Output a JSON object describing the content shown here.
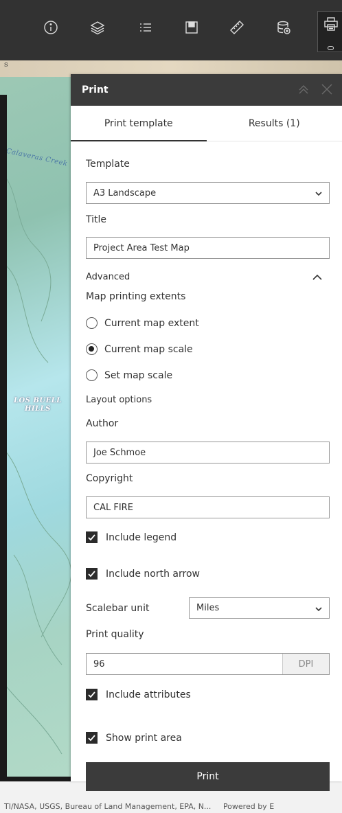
{
  "map": {
    "edge_label": "s",
    "creek_label": "Calaveras Creek",
    "hills_label_1": "LOS BUELL",
    "hills_label_2": "HILLS"
  },
  "attribution": {
    "text": "TI/NASA, USGS, Bureau of Land Management, EPA, N...",
    "powered": "Powered by E"
  },
  "panel": {
    "title": "Print",
    "tabs": [
      {
        "label": "Print template"
      },
      {
        "label": "Results (1)"
      }
    ],
    "template_label": "Template",
    "template_value": "A3 Landscape",
    "title_label": "Title",
    "title_value": "Project Area Test Map",
    "advanced_label": "Advanced",
    "extents_label": "Map printing extents",
    "extents_options": [
      {
        "label": "Current map extent",
        "checked": false
      },
      {
        "label": "Current map scale",
        "checked": true
      },
      {
        "label": "Set map scale",
        "checked": false
      }
    ],
    "layout_label": "Layout options",
    "author_label": "Author",
    "author_value": "Joe Schmoe",
    "copyright_label": "Copyright",
    "copyright_value": "CAL FIRE",
    "include_legend": "Include legend",
    "include_north_arrow": "Include north arrow",
    "scalebar_label": "Scalebar unit",
    "scalebar_value": "Miles",
    "quality_label": "Print quality",
    "quality_value": "96",
    "quality_unit": "DPI",
    "include_attributes": "Include attributes",
    "show_print_area": "Show print area",
    "print_button": "Print"
  },
  "colors": {
    "toolbar": "#323232",
    "panel_header": "#3b3b3b",
    "button": "#3b3b3b"
  }
}
